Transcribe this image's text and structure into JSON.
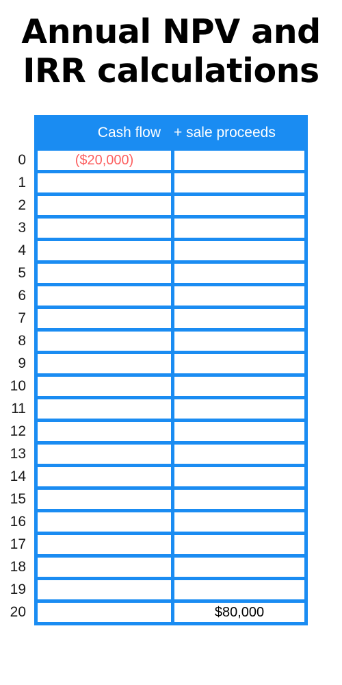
{
  "title": "Annual NPV and\nIRR calculations",
  "theme": {
    "accent_blue": "#1a8cf2",
    "negative_red": "#fc6060",
    "text_black": "#000000",
    "cell_white": "#ffffff"
  },
  "table": {
    "columns": [
      {
        "id": "cash_flow",
        "label": "Cash flow"
      },
      {
        "id": "sale_proceeds",
        "label": "+  sale proceeds"
      }
    ],
    "rows": [
      {
        "year": "0",
        "cash_flow": "($20,000)",
        "cash_flow_negative": true,
        "sale_proceeds": ""
      },
      {
        "year": "1",
        "cash_flow": "",
        "sale_proceeds": ""
      },
      {
        "year": "2",
        "cash_flow": "",
        "sale_proceeds": ""
      },
      {
        "year": "3",
        "cash_flow": "",
        "sale_proceeds": ""
      },
      {
        "year": "4",
        "cash_flow": "",
        "sale_proceeds": ""
      },
      {
        "year": "5",
        "cash_flow": "",
        "sale_proceeds": ""
      },
      {
        "year": "6",
        "cash_flow": "",
        "sale_proceeds": ""
      },
      {
        "year": "7",
        "cash_flow": "",
        "sale_proceeds": ""
      },
      {
        "year": "8",
        "cash_flow": "",
        "sale_proceeds": ""
      },
      {
        "year": "9",
        "cash_flow": "",
        "sale_proceeds": ""
      },
      {
        "year": "10",
        "cash_flow": "",
        "sale_proceeds": ""
      },
      {
        "year": "11",
        "cash_flow": "",
        "sale_proceeds": ""
      },
      {
        "year": "12",
        "cash_flow": "",
        "sale_proceeds": ""
      },
      {
        "year": "13",
        "cash_flow": "",
        "sale_proceeds": ""
      },
      {
        "year": "14",
        "cash_flow": "",
        "sale_proceeds": ""
      },
      {
        "year": "15",
        "cash_flow": "",
        "sale_proceeds": ""
      },
      {
        "year": "16",
        "cash_flow": "",
        "sale_proceeds": ""
      },
      {
        "year": "17",
        "cash_flow": "",
        "sale_proceeds": ""
      },
      {
        "year": "18",
        "cash_flow": "",
        "sale_proceeds": ""
      },
      {
        "year": "19",
        "cash_flow": "",
        "sale_proceeds": ""
      },
      {
        "year": "20",
        "cash_flow": "",
        "sale_proceeds": "$80,000"
      }
    ]
  }
}
